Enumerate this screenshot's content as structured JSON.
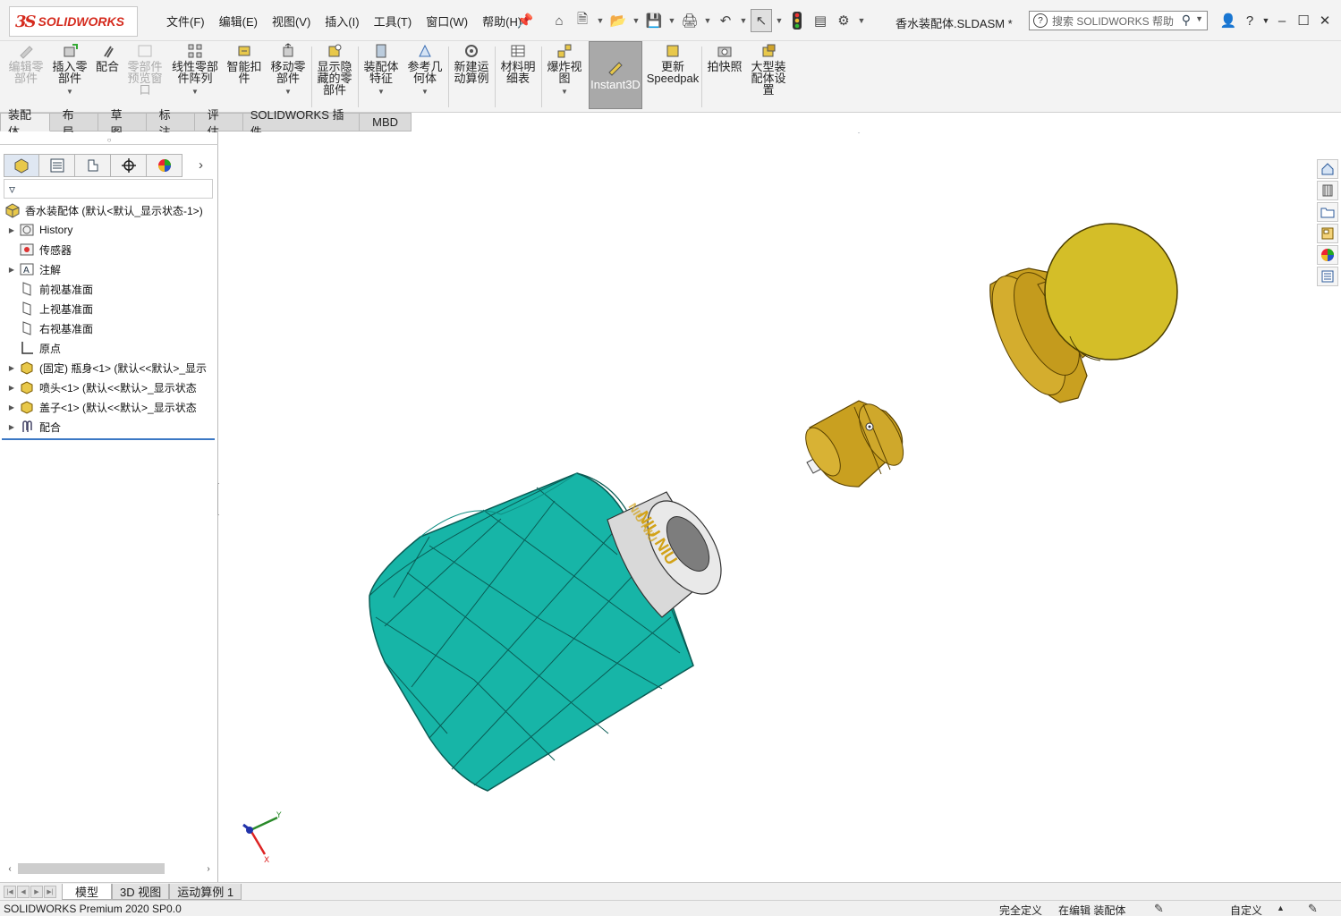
{
  "app": {
    "logo_ds": "3S",
    "logo_text": "SOLIDWORKS",
    "document_title": "香水装配体.SLDASM *"
  },
  "menu": [
    {
      "label": "文件(F)"
    },
    {
      "label": "编辑(E)"
    },
    {
      "label": "视图(V)"
    },
    {
      "label": "插入(I)"
    },
    {
      "label": "工具(T)"
    },
    {
      "label": "窗口(W)"
    },
    {
      "label": "帮助(H)"
    }
  ],
  "search": {
    "placeholder": "搜索 SOLIDWORKS 帮助"
  },
  "commands": [
    {
      "label_1": "编辑零",
      "label_2": "部件"
    },
    {
      "label_1": "插入零",
      "label_2": "部件"
    },
    {
      "label_1": "配合",
      "label_2": ""
    },
    {
      "label_1": "零部件",
      "label_2": "预览窗",
      "label_3": "口"
    },
    {
      "label_1": "线性零部",
      "label_2": "件阵列"
    },
    {
      "label_1": "智能扣",
      "label_2": "件"
    },
    {
      "label_1": "移动零",
      "label_2": "部件"
    },
    {
      "label_1": "显示隐",
      "label_2": "藏的零",
      "label_3": "部件"
    },
    {
      "label_1": "装配体",
      "label_2": "特征"
    },
    {
      "label_1": "参考几",
      "label_2": "何体"
    },
    {
      "label_1": "新建运",
      "label_2": "动算例"
    },
    {
      "label_1": "材料明",
      "label_2": "细表"
    },
    {
      "label_1": "爆炸视",
      "label_2": "图"
    },
    {
      "label_1": "Instant3D"
    },
    {
      "label_1": "更新",
      "label_2": "Speedpak"
    },
    {
      "label_1": "拍快照"
    },
    {
      "label_1": "大型装",
      "label_2": "配体设",
      "label_3": "置"
    }
  ],
  "tabs": [
    {
      "label": "装配体"
    },
    {
      "label": "布局"
    },
    {
      "label": "草图"
    },
    {
      "label": "标注"
    },
    {
      "label": "评估"
    },
    {
      "label": "SOLIDWORKS 插件"
    },
    {
      "label": "MBD"
    }
  ],
  "tree": {
    "root": "香水装配体  (默认<默认_显示状态-1>)",
    "items": [
      {
        "label": "History"
      },
      {
        "label": "传感器"
      },
      {
        "label": "注解"
      },
      {
        "label": "前视基准面"
      },
      {
        "label": "上视基准面"
      },
      {
        "label": "右视基准面"
      },
      {
        "label": "原点"
      },
      {
        "label": "(固定) 瓶身<1> (默认<<默认>_显示"
      },
      {
        "label": "喷头<1> (默认<<默认>_显示状态"
      },
      {
        "label": "盖子<1> (默认<<默认>_显示状态"
      },
      {
        "label": "配合"
      }
    ]
  },
  "bottom_tabs": [
    {
      "label": "模型"
    },
    {
      "label": "3D 视图"
    },
    {
      "label": "运动算例 1"
    }
  ],
  "status": {
    "product": "SOLIDWORKS Premium 2020 SP0.0",
    "state": "完全定义",
    "editing": "在编辑 装配体",
    "units": "自定义"
  },
  "model": {
    "bottle_text": "NIU NIU",
    "colors": {
      "bottle": "#17b5a7",
      "collar": "#d9d9d9",
      "gold": "#c9a020",
      "cap_sphere": "#d4be28"
    }
  },
  "triad": {
    "x": "X",
    "y": "Y"
  }
}
